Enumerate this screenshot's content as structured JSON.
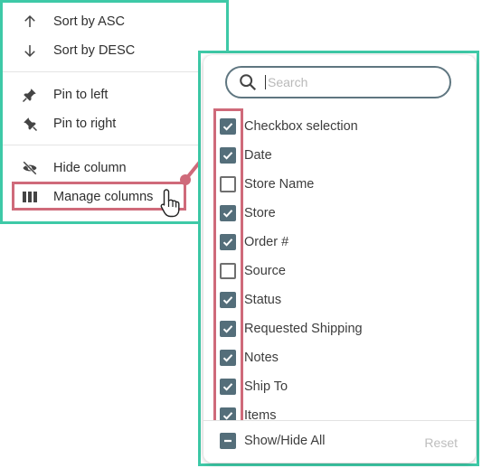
{
  "column_menu": {
    "items": [
      {
        "label": "Sort by ASC",
        "icon": "arrow-up-icon"
      },
      {
        "label": "Sort by DESC",
        "icon": "arrow-down-icon"
      },
      {
        "label": "Pin to left",
        "icon": "pin-left-icon"
      },
      {
        "label": "Pin to right",
        "icon": "pin-right-icon"
      },
      {
        "label": "Hide column",
        "icon": "eye-off-icon"
      },
      {
        "label": "Manage columns",
        "icon": "columns-icon"
      }
    ]
  },
  "manage_panel": {
    "search_placeholder": "Search",
    "search_value": "",
    "columns": [
      {
        "label": "Checkbox selection",
        "checked": true
      },
      {
        "label": "Date",
        "checked": true
      },
      {
        "label": "Store Name",
        "checked": false
      },
      {
        "label": "Store",
        "checked": true
      },
      {
        "label": "Order #",
        "checked": true
      },
      {
        "label": "Source",
        "checked": false
      },
      {
        "label": "Status",
        "checked": true
      },
      {
        "label": "Requested Shipping",
        "checked": true
      },
      {
        "label": "Notes",
        "checked": true
      },
      {
        "label": "Ship To",
        "checked": true
      },
      {
        "label": "Items",
        "checked": true
      }
    ],
    "show_hide_all_label": "Show/Hide All",
    "reset_label": "Reset"
  },
  "colors": {
    "frame": "#3ec9a7",
    "highlight": "#cf6a7a",
    "checkbox": "#546e7a"
  }
}
